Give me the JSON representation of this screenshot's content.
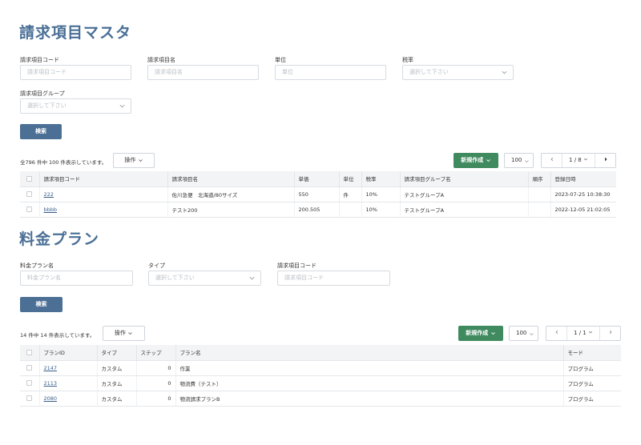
{
  "section1": {
    "title": "請求項目マスタ",
    "filters": {
      "code": {
        "label": "請求項目コード",
        "placeholder": "請求項目コード"
      },
      "name": {
        "label": "請求項目名",
        "placeholder": "請求項目名"
      },
      "unit": {
        "label": "単位",
        "placeholder": "単位"
      },
      "tax": {
        "label": "税率",
        "placeholder": "選択して下さい"
      },
      "group": {
        "label": "請求項目グループ",
        "placeholder": "選択して下さい"
      }
    },
    "search_label": "検索",
    "count_text": "全796 件中 100 件表示しています。",
    "operation_label": "操作",
    "new_label": "新規作成",
    "page_size": "100",
    "pager_text": "1 / 8",
    "columns": [
      "請求項目コード",
      "請求項目名",
      "単価",
      "単位",
      "税率",
      "請求項目グループ名",
      "順序",
      "登録日時"
    ],
    "rows": [
      {
        "code": "222",
        "name": "佐川急便　北海道/80サイズ",
        "price": "550",
        "unit": "件",
        "tax": "10%",
        "group": "テストグループA",
        "order": "",
        "date": "2023-07-25 10:38:30"
      },
      {
        "code": "bbbb",
        "name": "テスト200",
        "price": "200.505",
        "unit": "",
        "tax": "10%",
        "group": "テストグループA",
        "order": "",
        "date": "2022-12-05 21:02:05"
      }
    ]
  },
  "section2": {
    "title": "料金プラン",
    "filters": {
      "name": {
        "label": "料金プラン名",
        "placeholder": "料金プラン名"
      },
      "type": {
        "label": "タイプ",
        "placeholder": "選択して下さい"
      },
      "code": {
        "label": "請求項目コード",
        "placeholder": "請求項目コード"
      }
    },
    "search_label": "検索",
    "count_text": "14 件中 14 件表示しています。",
    "operation_label": "操作",
    "new_label": "新規作成",
    "page_size": "100",
    "pager_text": "1 / 1",
    "columns": [
      "プランID",
      "タイプ",
      "ステップ",
      "プラン名",
      "モード"
    ],
    "rows": [
      {
        "id": "2147",
        "type": "カスタム",
        "step": "0",
        "name": "作業",
        "mode": "プログラム"
      },
      {
        "id": "2113",
        "type": "カスタム",
        "step": "0",
        "name": "物流費（テスト）",
        "mode": "プログラム"
      },
      {
        "id": "2080",
        "type": "カスタム",
        "step": "0",
        "name": "物流請求プランB",
        "mode": "プログラム"
      }
    ]
  },
  "colors": {
    "title": "#4a6f96",
    "search_button": "#4b6f95",
    "new_button": "#3f8a5f",
    "link": "#3a5f8a"
  },
  "icons": {
    "caret": "chevron-down-icon",
    "prev": "chevron-left-icon",
    "next": "chevron-right-icon"
  }
}
